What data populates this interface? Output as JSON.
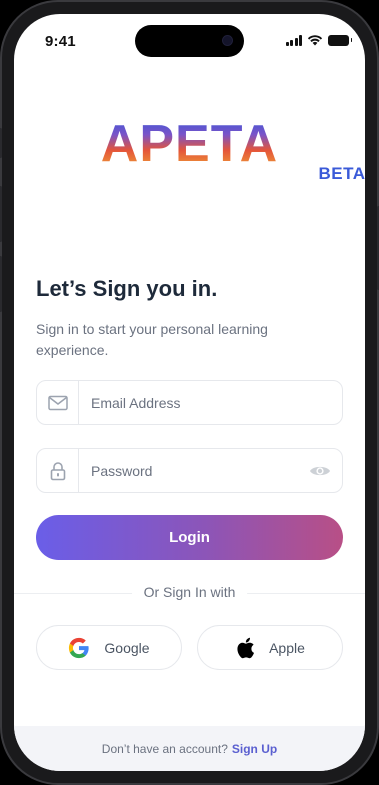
{
  "status_bar": {
    "time": "9:41"
  },
  "logo": {
    "word": "APETA",
    "badge": "BETA"
  },
  "heading": {
    "title": "Let’s Sign you in.",
    "subtitle": "Sign in to start your personal learning experience."
  },
  "form": {
    "email": {
      "placeholder": "Email Address",
      "value": "",
      "icon": "mail-icon"
    },
    "password": {
      "placeholder": "Password",
      "value": "",
      "icon": "lock-icon",
      "toggle_icon": "eye-icon"
    },
    "login_label": "Login"
  },
  "divider_text": "Or Sign In with",
  "social": [
    {
      "label": "Google",
      "icon": "google-icon"
    },
    {
      "label": "Apple",
      "icon": "apple-icon"
    }
  ],
  "footer": {
    "prompt": "Don’t have an account?",
    "link": "Sign Up"
  },
  "colors": {
    "accent_start": "#6a5ee8",
    "accent_end": "#b84f86",
    "title": "#1e2a3a",
    "link": "#5a5fd0"
  }
}
